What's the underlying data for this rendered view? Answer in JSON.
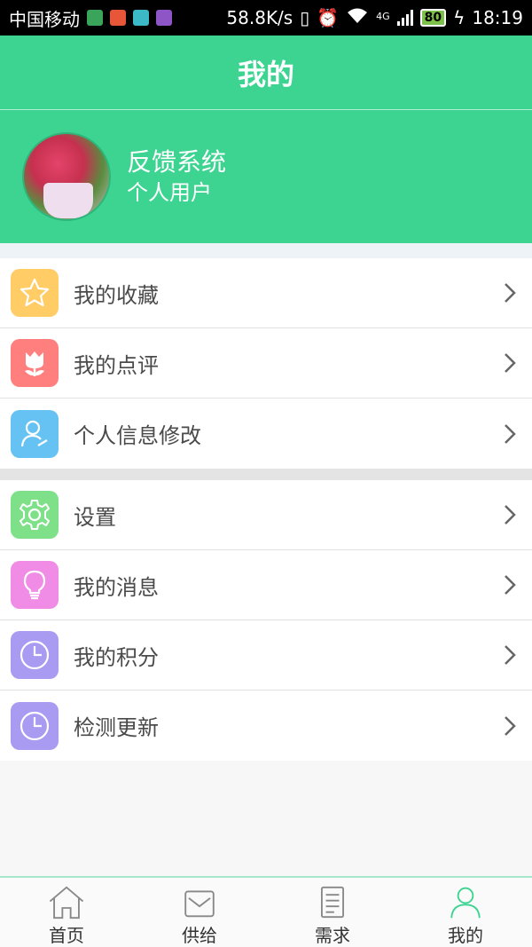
{
  "status_bar": {
    "carrier": "中国移动",
    "speed": "58.8K/s",
    "network": "4G",
    "battery": "80",
    "time": "18:19"
  },
  "header": {
    "title": "我的"
  },
  "profile": {
    "name": "反馈系统",
    "role": "个人用户"
  },
  "menu_group1": [
    {
      "label": "我的收藏",
      "icon": "star-icon",
      "color": "#ffcc66"
    },
    {
      "label": "我的点评",
      "icon": "tulip-icon",
      "color": "#ff7f7f"
    },
    {
      "label": "个人信息修改",
      "icon": "user-edit-icon",
      "color": "#66c2f2"
    }
  ],
  "menu_group2": [
    {
      "label": "设置",
      "icon": "gear-icon",
      "color": "#7fe08a"
    },
    {
      "label": "我的消息",
      "icon": "lightbulb-icon",
      "color": "#f08ce6"
    },
    {
      "label": "我的积分",
      "icon": "clock-icon",
      "color": "#a99af2"
    },
    {
      "label": "检测更新",
      "icon": "clock-icon",
      "color": "#a99af2"
    }
  ],
  "tabbar": {
    "tabs": [
      {
        "label": "首页",
        "icon": "home-icon"
      },
      {
        "label": "供给",
        "icon": "mail-icon"
      },
      {
        "label": "需求",
        "icon": "document-icon"
      },
      {
        "label": "我的",
        "icon": "person-icon",
        "active": true
      }
    ],
    "active_color": "#3dd492"
  }
}
